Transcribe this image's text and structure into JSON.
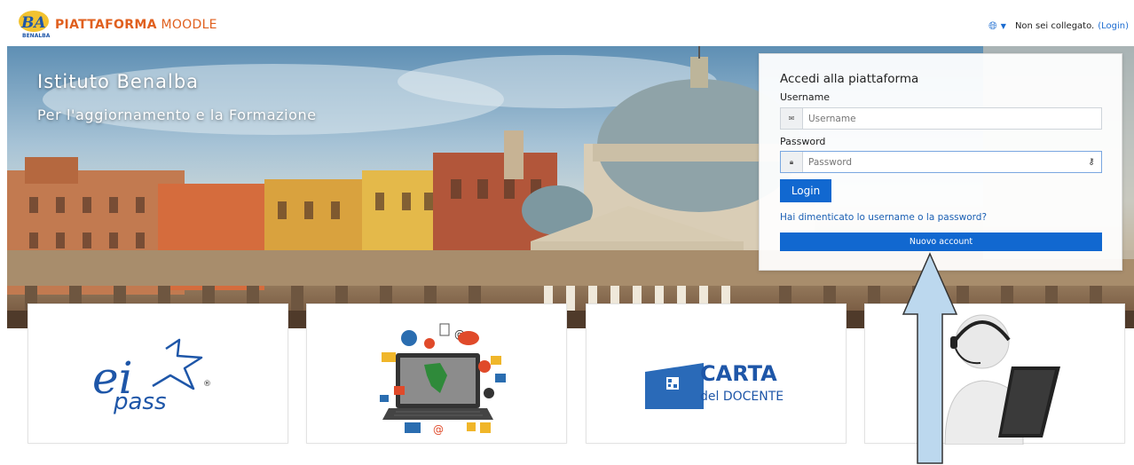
{
  "header": {
    "logo_text": "BA",
    "logo_subtext": "BENALBA",
    "brand_bold": "PIATTAFORMA",
    "brand_light": "MOODLE",
    "status_text": "Non sei collegato.",
    "login_link": "(Login)"
  },
  "hero": {
    "title": "Istituto Benalba",
    "subtitle": "Per l'aggiornamento e la Formazione"
  },
  "login": {
    "title": "Accedi alla piattaforma",
    "username_label": "Username",
    "username_placeholder": "Username",
    "password_label": "Password",
    "password_placeholder": "Password",
    "login_button": "Login",
    "forgot_link": "Hai dimenticato lo username o la password?",
    "new_account_button": "Nuovo account"
  },
  "cards": [
    {
      "name": "eipass",
      "text_main": "ei",
      "text_sub": "pass",
      "registered": "®"
    },
    {
      "name": "digital-communication"
    },
    {
      "name": "carta-docente",
      "text_main": "CARTA",
      "text_sub": "del DOCENTE"
    },
    {
      "name": "support"
    }
  ],
  "colors": {
    "brand_orange": "#e0601f",
    "primary_blue": "#1168d0",
    "link_blue": "#1a5fb4",
    "eipass_blue": "#1e56a8",
    "arrow_fill": "#bcd8ee"
  }
}
